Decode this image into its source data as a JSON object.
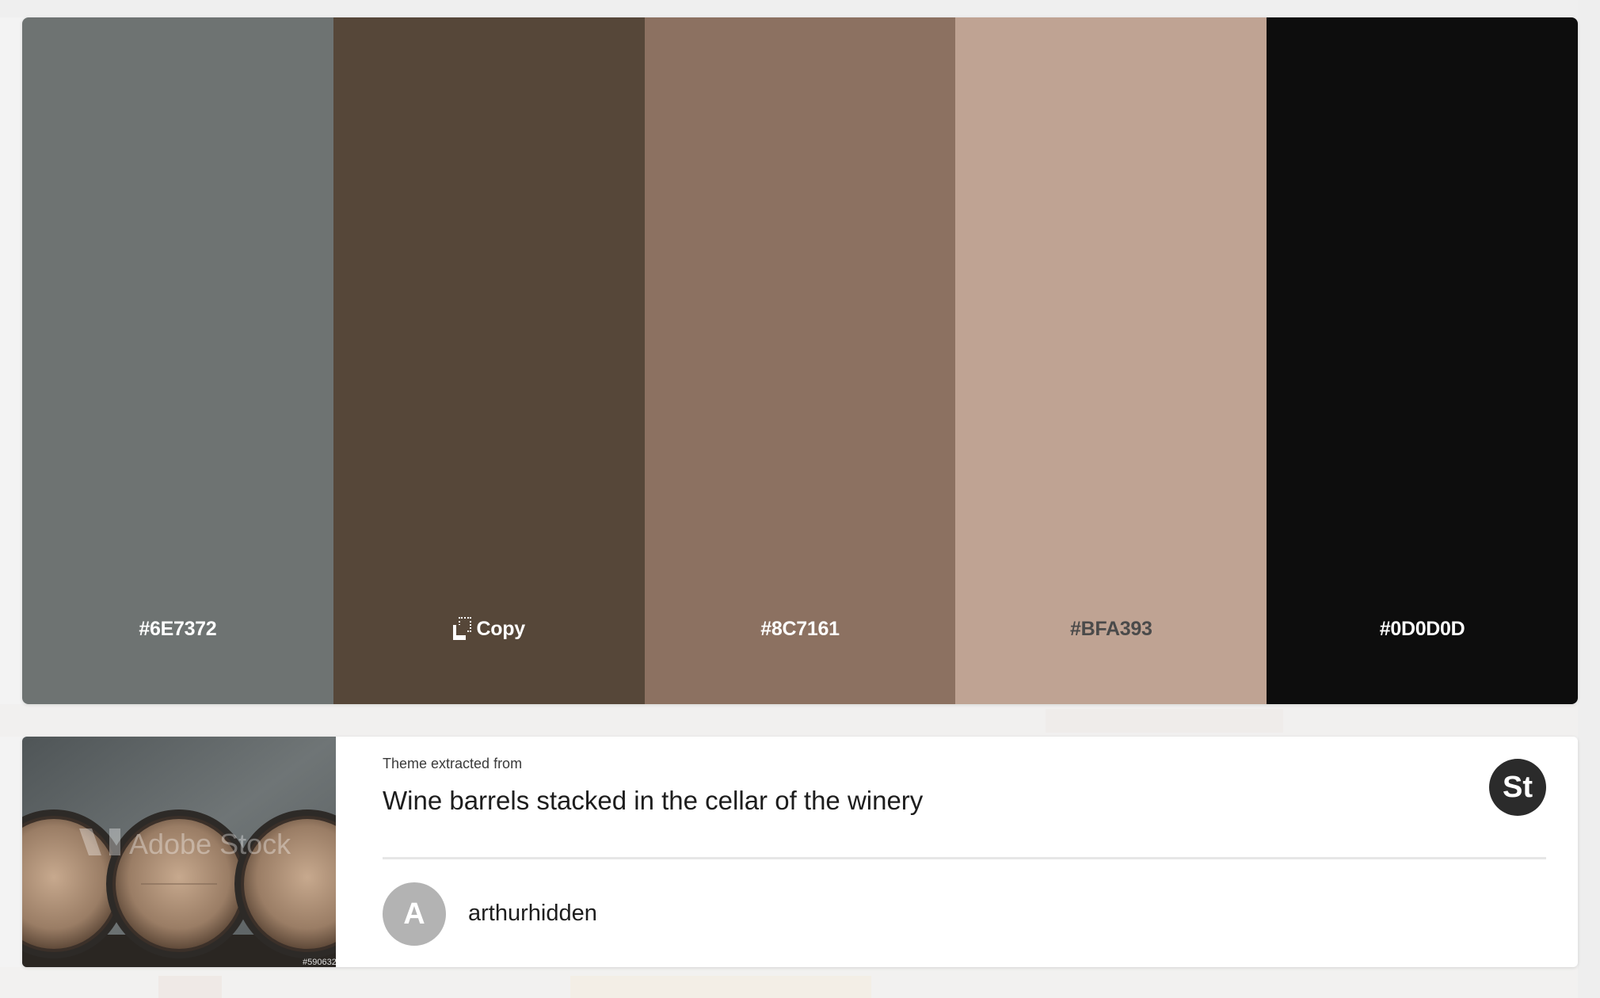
{
  "palette": {
    "swatches": [
      {
        "hex": "#6E7372",
        "label": "#6E7372",
        "text_color": "#ffffff"
      },
      {
        "hex": "#564739",
        "label": "Copy",
        "text_color": "#ffffff",
        "icon": "copy-icon"
      },
      {
        "hex": "#8C7161",
        "label": "#8C7161",
        "text_color": "#ffffff"
      },
      {
        "hex": "#BFA393",
        "label": "#BFA393",
        "text_color": "#4a4a4a"
      },
      {
        "hex": "#0D0D0D",
        "label": "#0D0D0D",
        "text_color": "#ffffff"
      }
    ]
  },
  "source": {
    "extracted_label": "Theme extracted from",
    "title": "Wine barrels stacked in the cellar of the winery",
    "badge": "St",
    "thumbnail_watermark": "Adobe Stock",
    "thumbnail_id": "#590632"
  },
  "author": {
    "initial": "A",
    "name": "arthurhidden"
  },
  "colors": {
    "page_background": "#f3f3f3",
    "card_background": "#ffffff",
    "badge_background": "#2b2b2b",
    "avatar_background": "#b3b3b3"
  }
}
